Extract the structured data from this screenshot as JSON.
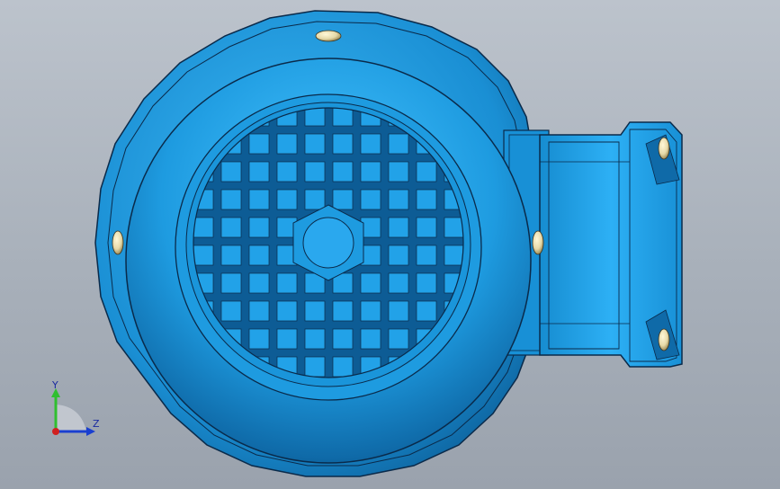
{
  "viewport": {
    "background_top": "#bcc3cc",
    "background_bottom": "#9aa2ad"
  },
  "model": {
    "body_color": "#1e9be0",
    "edge_color": "#0a2a4a",
    "bolt_color": "#e6d9a8"
  },
  "triad": {
    "y_label": "Y",
    "z_label": "Z",
    "y_color": "#2fbf2f",
    "z_color": "#1a3fd0",
    "x_color": "#d02020"
  }
}
